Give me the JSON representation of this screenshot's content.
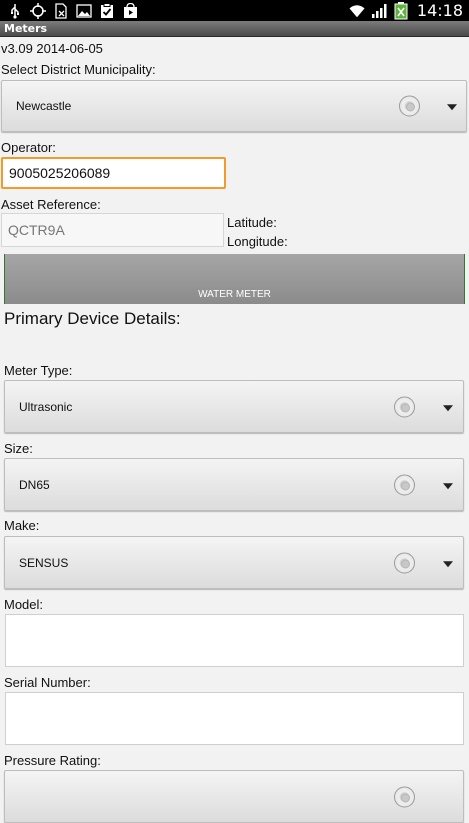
{
  "status_bar": {
    "time": "14:18",
    "left_icons": [
      "usb-icon",
      "gps-icon",
      "no-sim-icon",
      "gallery-icon",
      "clipboard-check-icon",
      "play-store-icon"
    ],
    "right_icons": [
      "wifi-icon",
      "signal-icon",
      "battery-charging-icon"
    ]
  },
  "title_bar": {
    "title": "Meters"
  },
  "version": "v3.09 2014-06-05",
  "district": {
    "label": "Select District Municipality:",
    "value": "Newcastle"
  },
  "operator": {
    "label": "Operator:",
    "value": "9005025206089"
  },
  "asset": {
    "label": "Asset Reference:",
    "value": "QCTR9A",
    "latitude_label": "Latitude:",
    "longitude_label": "Longitude:"
  },
  "banner": {
    "label": "WATER METER"
  },
  "primary_heading": "Primary Device Details:",
  "meter_type": {
    "label": "Meter Type:",
    "value": "Ultrasonic"
  },
  "size": {
    "label": "Size:",
    "value": "DN65"
  },
  "make": {
    "label": "Make:",
    "value": "SENSUS"
  },
  "model": {
    "label": "Model:",
    "value": ""
  },
  "serial": {
    "label": "Serial Number:",
    "value": ""
  },
  "pressure": {
    "label": "Pressure Rating:"
  }
}
